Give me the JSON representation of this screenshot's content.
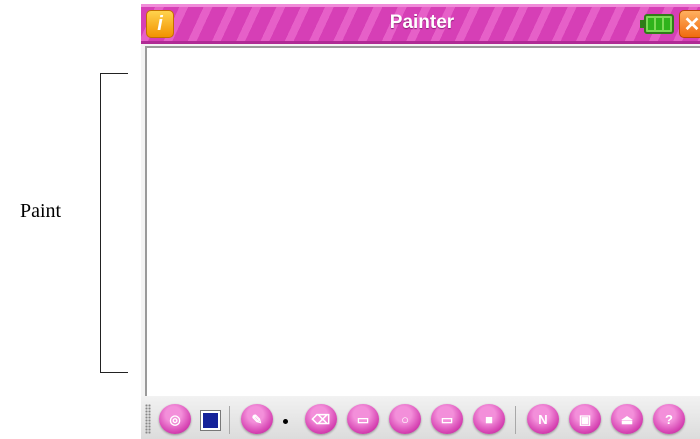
{
  "annotation": {
    "label": "Paint"
  },
  "window": {
    "title": "Painter",
    "info_icon_text": "i",
    "close_icon_text": "✕",
    "titlebar_color": "#d63fb6",
    "battery_color": "#2fb31b"
  },
  "toolbar": {
    "accent_color": "#d43fb0",
    "selected_color": "#16239a",
    "tools": [
      {
        "name": "palette-icon",
        "glyph": "◎"
      },
      {
        "name": "pencil-icon",
        "glyph": "✎"
      },
      {
        "name": "eraser-icon",
        "glyph": "⌫"
      },
      {
        "name": "dotted-rect-icon",
        "glyph": "▭"
      },
      {
        "name": "circle-icon",
        "glyph": "○"
      },
      {
        "name": "rectangle-icon",
        "glyph": "▭"
      },
      {
        "name": "filled-rect-icon",
        "glyph": "■"
      },
      {
        "name": "new-icon",
        "glyph": "N"
      },
      {
        "name": "save-icon",
        "glyph": "▣"
      },
      {
        "name": "eject-icon",
        "glyph": "⏏"
      },
      {
        "name": "help-icon",
        "glyph": "?"
      }
    ]
  }
}
